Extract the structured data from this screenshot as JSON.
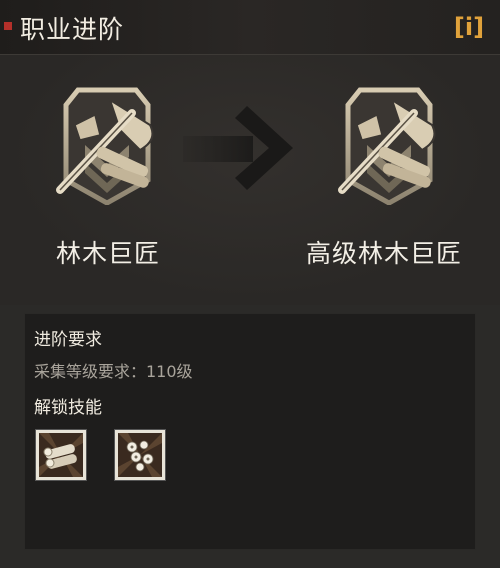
{
  "header": {
    "title": "职业进阶",
    "info_label": "i"
  },
  "advancement": {
    "from_name": "林木巨匠",
    "to_name": "高级林木巨匠",
    "from_icon": "woodcutter-badge-icon",
    "to_icon": "woodcutter-badge-icon",
    "arrow_icon": "right-arrow-icon"
  },
  "requirements": {
    "title": "进阶要求",
    "line": "采集等级要求：110级"
  },
  "unlock": {
    "title": "解锁技能",
    "skills": [
      {
        "icon": "logs-skill-icon"
      },
      {
        "icon": "flowers-skill-icon"
      }
    ]
  },
  "colors": {
    "accent": "#e0a23b",
    "bullet": "#b3302a",
    "badge": "#c9bba0"
  }
}
